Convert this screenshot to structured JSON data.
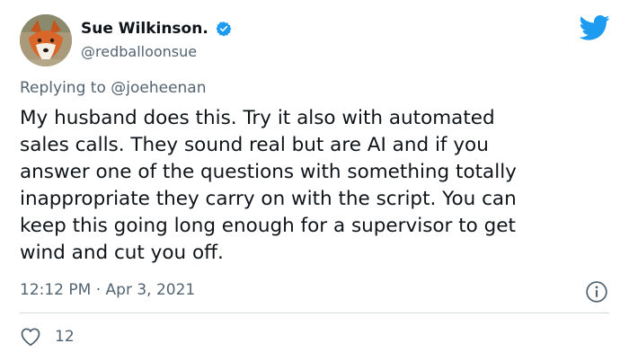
{
  "author": {
    "display_name": "Sue Wilkinson.",
    "handle": "@redballoonsue"
  },
  "reply": {
    "prefix": "Replying to ",
    "mention": "@joeheenan"
  },
  "tweet": {
    "text": "My husband does this.  Try it also with automated\nsales calls.  They sound real but are AI and if you\nanswer one of the questions with something totally\ninappropriate they carry on with the script.  You can\nkeep this going long enough for a supervisor to get\nwind and cut you off.",
    "timestamp": "12:12 PM · Apr 3, 2021",
    "like_count": "12"
  },
  "icons": {
    "verified": "verified-badge-icon",
    "brand": "twitter-bird-icon",
    "info": "info-icon",
    "like": "heart-icon"
  },
  "colors": {
    "brand": "#1d9bf0",
    "text": "#0f1419",
    "secondary": "#536471",
    "divider": "#cfd9de"
  }
}
